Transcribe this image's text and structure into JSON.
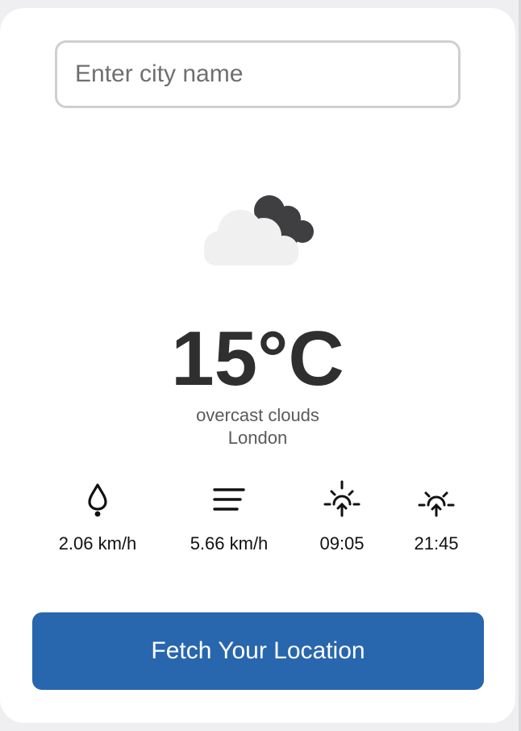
{
  "search": {
    "placeholder": "Enter city name",
    "value": ""
  },
  "weather": {
    "icon": "overcast-clouds-icon",
    "temperature": "15°C",
    "description": "overcast clouds",
    "city": "London"
  },
  "stats": [
    {
      "icon": "humidity-drop-icon",
      "value": "2.06 km/h"
    },
    {
      "icon": "wind-lines-icon",
      "value": "5.66 km/h"
    },
    {
      "icon": "sunrise-icon",
      "value": "09:05"
    },
    {
      "icon": "sunset-icon",
      "value": "21:45"
    }
  ],
  "actions": {
    "fetch_label": "Fetch Your Location"
  },
  "colors": {
    "button": "#2866ae",
    "text": "#2f2f2f",
    "muted": "#5a5a5a"
  }
}
